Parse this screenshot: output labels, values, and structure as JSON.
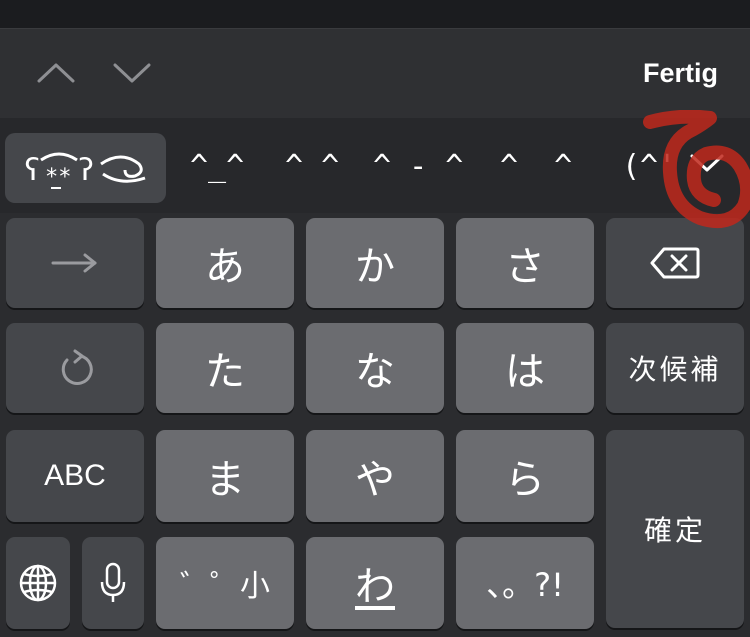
{
  "toolbar": {
    "prev_icon": "chevron-up-icon",
    "next_icon": "chevron-down-icon",
    "done_label": "Fertig"
  },
  "candidates": {
    "kaomoji_icon": "kaomoji-icon",
    "items": [
      "^_^",
      "^ ^",
      "^ - ^",
      "^  ^",
      "(^'"
    ],
    "expand_icon": "chevron-down-icon"
  },
  "keys": {
    "right_arrow_icon": "arrow-right-icon",
    "a": "あ",
    "ka": "か",
    "sa": "さ",
    "backspace_icon": "backspace-icon",
    "undo_icon": "undo-icon",
    "ta": "た",
    "na": "な",
    "ha": "は",
    "next_candidate": "次候補",
    "abc": "ABC",
    "ma": "ま",
    "ya": "や",
    "ra": "ら",
    "confirm": "確定",
    "globe_icon": "globe-icon",
    "mic_icon": "microphone-icon",
    "dakuten": "゛゜小",
    "wa": "わ",
    "punct": "、。?!"
  },
  "colors": {
    "background": "#2b2c2f",
    "light_key": "#6b6c70",
    "dark_key": "#45474b",
    "annotation_red": "#c0281c"
  }
}
